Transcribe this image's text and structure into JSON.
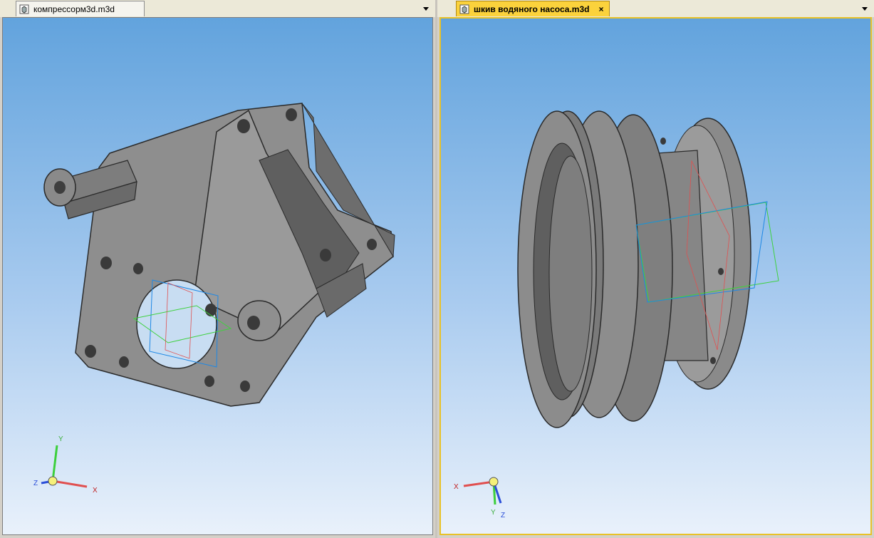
{
  "left_window": {
    "tab_title": "компрессорм3d.m3d",
    "triad": {
      "y_label": "Y",
      "x_label": "X",
      "z_label": "Z"
    }
  },
  "right_window": {
    "tab_title": "шкив водяного насоса.m3d",
    "close_glyph": "×",
    "triad": {
      "y_label": "Y",
      "x_label": "X",
      "z_label": "Z"
    }
  },
  "colors": {
    "viewport_top": "#62a3dd",
    "viewport_bottom": "#e9f1fb",
    "active_tab": "#fbd23c",
    "model_gray": "#8c8c8c"
  },
  "icons": [
    "document-3d-icon",
    "close-icon",
    "dropdown-arrow-icon"
  ]
}
